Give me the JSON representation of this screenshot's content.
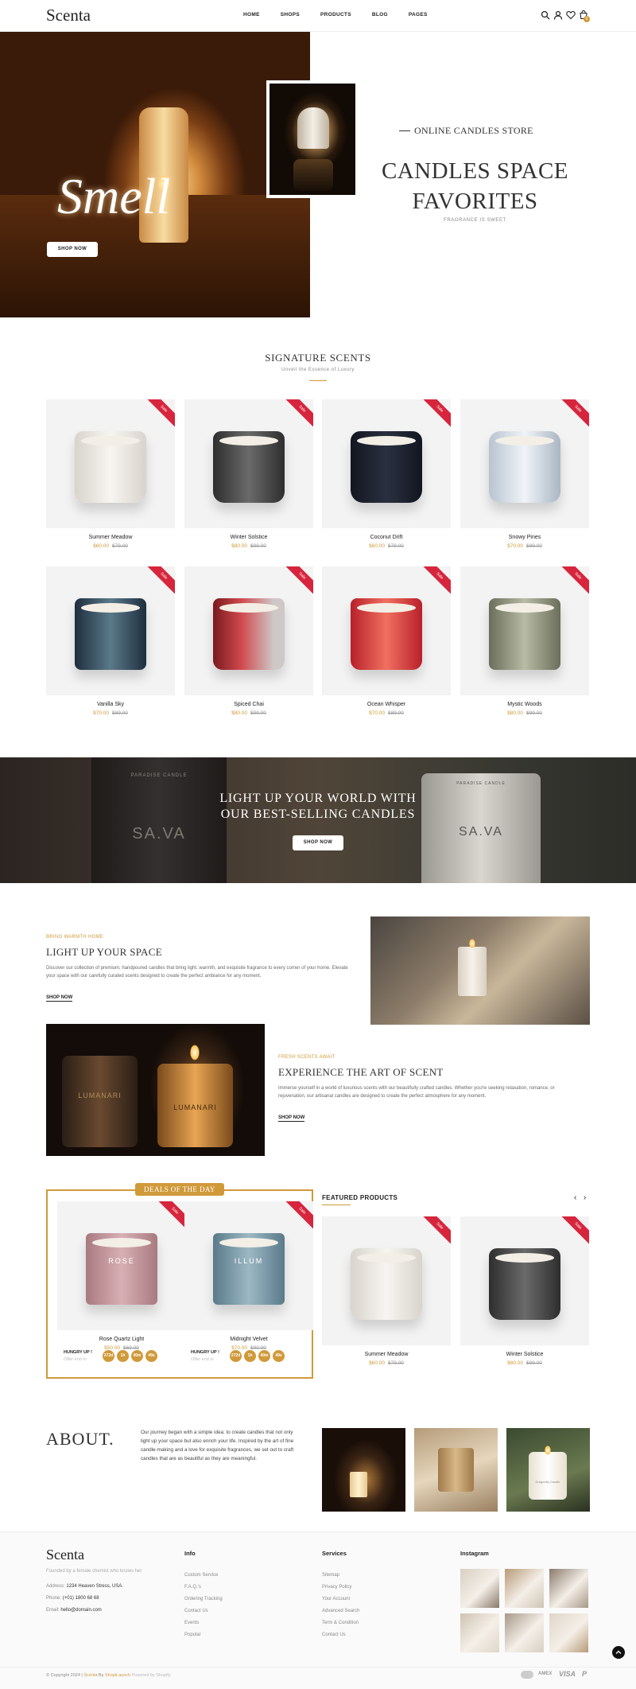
{
  "header": {
    "logo": "Scenta",
    "nav": [
      "HOME",
      "SHOPS",
      "PRODUCTS",
      "BLOG",
      "PAGES"
    ],
    "cart_count": "0"
  },
  "hero": {
    "script_text": "Smell",
    "button": "SHOP NOW",
    "eyebrow": "ONLINE CANDLES STORE",
    "title_line1": "CANDLES SPACE",
    "title_line2": "FAVORITES",
    "subtitle": "FRAGRANCE IS SWEET"
  },
  "signature": {
    "title": "SIGNATURE SCENTS",
    "subtitle": "Unveil the Essence of Luxury",
    "ribbon": "Sale",
    "products": [
      {
        "name": "Summer Meadow",
        "price": "$60.00",
        "old": "$79.00"
      },
      {
        "name": "Winter Solstice",
        "price": "$80.00",
        "old": "$99.00"
      },
      {
        "name": "Coconut Drift",
        "price": "$60.00",
        "old": "$79.00"
      },
      {
        "name": "Snowy Pines",
        "price": "$70.00",
        "old": "$89.00"
      },
      {
        "name": "Vanilla Sky",
        "price": "$70.00",
        "old": "$89.00"
      },
      {
        "name": "Spiced Chai",
        "price": "$80.00",
        "old": "$99.00"
      },
      {
        "name": "Ocean Whisper",
        "price": "$70.00",
        "old": "$89.00"
      },
      {
        "name": "Mystic Woods",
        "price": "$80.00",
        "old": "$99.00"
      }
    ]
  },
  "banner": {
    "line1": "LIGHT UP YOUR WORLD WITH",
    "line2": "OUR BEST-SELLING CANDLES",
    "button": "SHOP NOW",
    "jar_left_top": "PARADISE CANDLE",
    "jar_left": "SA.VA",
    "jar_right": "SA.VA",
    "jar_right_top": "PARADISE CANDLE"
  },
  "feature1": {
    "eyebrow": "BRING WARMTH HOME",
    "title": "LIGHT UP YOUR SPACE",
    "text": "Discover our collection of premium, handpoured candles that bring light, warmth, and exquisite fragrance to every corner of your home. Elevate your space with our carefully curated scents designed to create the perfect ambiance for any moment.",
    "link": "SHOP NOW"
  },
  "feature2": {
    "eyebrow": "FRESH SCENTS AWAIT",
    "title": "EXPERIENCE THE ART OF SCENT",
    "text": "Immerse yourself in a world of luxurious scents with our beautifully crafted candles. Whether you're seeking relaxation, romance, or rejuvenation, our artisanal candles are designed to create the perfect atmosphere for any moment.",
    "link": "SHOP NOW",
    "jar_label_left": "LUMANARI",
    "jar_label_right": "LUMANARI"
  },
  "deals": {
    "label": "DEALS OF THE DAY",
    "ribbon": "Sale",
    "products": [
      {
        "name": "Rose Quartz Light",
        "price": "$50.00",
        "old": "$69.00",
        "jar": "ROSE"
      },
      {
        "name": "Midnight Velvet",
        "price": "$70.00",
        "old": "$90.00",
        "jar": "ILLUM"
      }
    ],
    "hungry": "HUNGRY UP !",
    "offer": "Offer end in",
    "timer": [
      "272d",
      "1h",
      "40m",
      "49s"
    ]
  },
  "featured": {
    "title": "FEATURED PRODUCTS",
    "prev": "‹",
    "next": "›",
    "ribbon": "Sale",
    "products": [
      {
        "name": "Summer Meadow",
        "price": "$60.00",
        "old": "$79.00"
      },
      {
        "name": "Winter Solstice",
        "price": "$80.00",
        "old": "$99.00"
      }
    ]
  },
  "about": {
    "title": "ABOUT.",
    "text": "Our journey began with a simple idea: to create candles that not only light up your space but also enrich your life. Inspired by the art of fine candle-making and a love for exquisite fragrances, we set out to craft candles that are as beautiful as they are meaningful.",
    "jar_label": "Dragonfly Candle"
  },
  "footer": {
    "logo": "Scenta",
    "tagline": "Founded by a female chemist who knows her",
    "address_label": "Address:",
    "address": "1234 Heaven Stress, USA.",
    "phone_label": "Phone:",
    "phone": "(+01) 1800 68 68",
    "email_label": "Email:",
    "email": "hello@domain.com",
    "info_title": "Info",
    "info_links": [
      "Custom Service",
      "F.A.Q.'s",
      "Ordering Tracking",
      "Contact Us",
      "Events",
      "Popular"
    ],
    "services_title": "Services",
    "services_links": [
      "Sitemap",
      "Privacy Policy",
      "Your Account",
      "Advanced Search",
      "Term & Condition",
      "Contact Us"
    ],
    "instagram_title": "Instagram",
    "copyright_pre": "© Copyright 2024 |",
    "copyright_brand": "Scenta",
    "copyright_mid": "By",
    "copyright_author": "ShopiLaunch",
    "copyright_post": "Powered by Shopify.",
    "payments": [
      "AMEX",
      "VISA",
      "P"
    ]
  },
  "colors": {
    "accent": "#d09a3a",
    "sale": "#d6253c",
    "dark": "#222222"
  }
}
